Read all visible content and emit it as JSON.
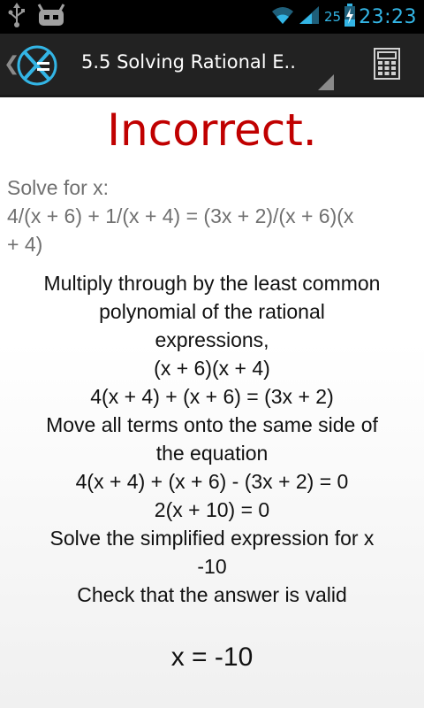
{
  "status_bar": {
    "battery_level": "25",
    "time": "23:23",
    "icons": [
      "usb-icon",
      "android-icon",
      "wifi-icon",
      "signal-icon",
      "battery-charging-icon"
    ]
  },
  "action_bar": {
    "title": "5.5 Solving Rational E..",
    "icons": [
      "up-chevron-icon",
      "app-logo-icon",
      "spinner-indicator-icon",
      "calculator-icon"
    ],
    "accent_color": "#33b5e5"
  },
  "content": {
    "result": "Incorrect.",
    "result_color": "#c00000",
    "question_label": "Solve for x:",
    "question_expression_line1": "4/(x + 6) + 1/(x + 4) = (3x + 2)/(x + 6)(x",
    "question_expression_line2": "+ 4)",
    "steps": [
      "Multiply through by the least common",
      "polynomial of the rational",
      "expressions,",
      "(x + 6)(x + 4)",
      "4(x + 4) + (x + 6) = (3x + 2)",
      "Move all terms onto the same side of",
      "the equation",
      "4(x + 4) + (x + 6) - (3x + 2) = 0",
      "2(x + 10) = 0",
      "Solve the simplified expression for x",
      "-10",
      "Check that the answer is valid"
    ],
    "answer": "x = -10"
  }
}
